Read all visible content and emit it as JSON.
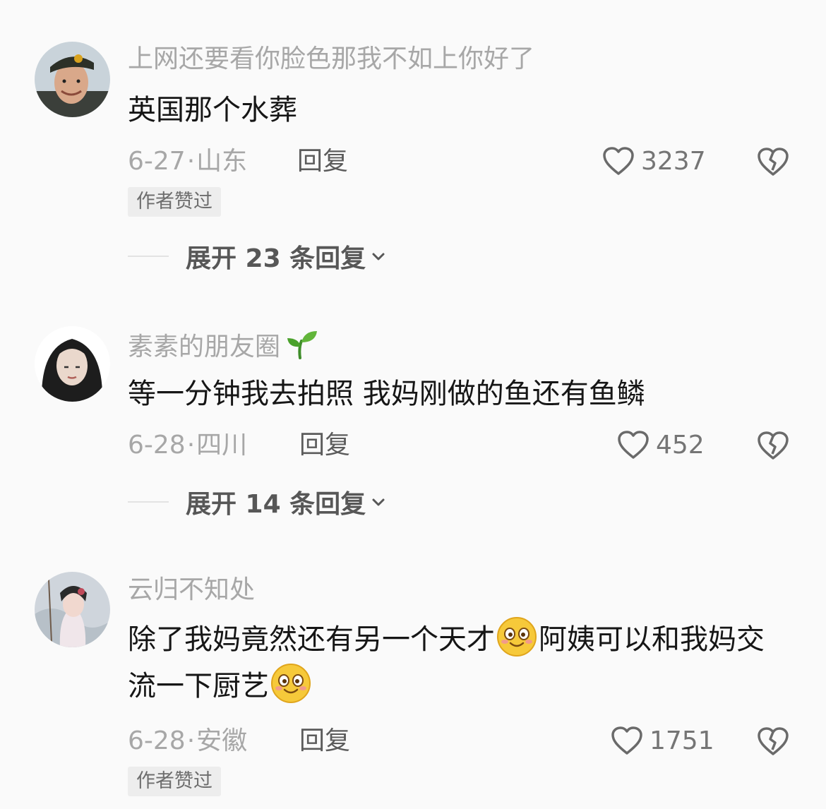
{
  "comments": [
    {
      "username": "上网还要看你脸色那我不如上你好了",
      "content": "英国那个水葬",
      "date": "6-27",
      "separator": "·",
      "location": "山东",
      "reply_label": "回复",
      "likes": "3237",
      "badge": "作者赞过",
      "expand": "展开 23 条回复"
    },
    {
      "username": "素素的朋友圈",
      "username_icon": "sprout-icon",
      "content": "等一分钟我去拍照 我妈刚做的鱼还有鱼鳞",
      "date": "6-28",
      "separator": "·",
      "location": "四川",
      "reply_label": "回复",
      "likes": "452",
      "expand": "展开 14 条回复"
    },
    {
      "username": "云归不知处",
      "content_part1": "除了我妈竟然还有另一个天才",
      "content_part2": "阿姨可以和我妈交流一下厨艺",
      "content_icon": "smiling-face-icon",
      "date": "6-28",
      "separator": "·",
      "location": "安徽",
      "reply_label": "回复",
      "likes": "1751",
      "badge": "作者赞过"
    }
  ],
  "colors": {
    "background": "#fafafa",
    "username": "#a7a7a7",
    "content": "#161616",
    "reply": "#5b5b5b",
    "badge_bg": "#ededed"
  }
}
